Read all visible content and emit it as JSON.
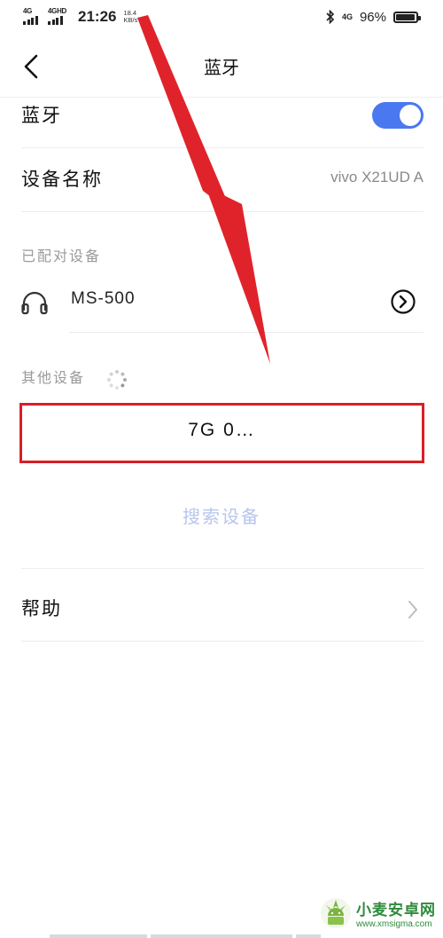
{
  "status_bar": {
    "signal1_label": "4G",
    "signal2_label": "4GHD",
    "time": "21:26",
    "speed_value": "18.4",
    "speed_unit": "KB/s",
    "network_label": "4G",
    "battery_text": "96%",
    "battery_level": 0.96,
    "icons": [
      "signal-icon",
      "bluetooth-icon",
      "battery-icon"
    ]
  },
  "header": {
    "title": "蓝牙",
    "back_icon": "chevron-left-icon"
  },
  "bluetooth_row": {
    "label": "蓝牙",
    "toggle_on": true,
    "accent_color": "#4a78f0"
  },
  "device_name_row": {
    "label": "设备名称",
    "value": "vivo X21UD A"
  },
  "paired_section": {
    "header": "已配对设备",
    "devices": [
      {
        "name": "MS-500",
        "icon": "headphones-icon",
        "action_icon": "chevron-circle-right-icon"
      }
    ]
  },
  "other_section": {
    "header": "其他设备",
    "loading_icon": "spinner-icon",
    "devices": [
      {
        "name": "7G 0…"
      }
    ],
    "highlight_color": "#d81f26"
  },
  "search_button": {
    "label": "搜索设备",
    "color": "#b7c6ec"
  },
  "help_row": {
    "label": "帮助",
    "icon": "chevron-right-icon"
  },
  "annotation": {
    "arrow_color": "#e0232b"
  },
  "watermark": {
    "title": "小麦安卓网",
    "url": "www.xmsigma.com"
  }
}
